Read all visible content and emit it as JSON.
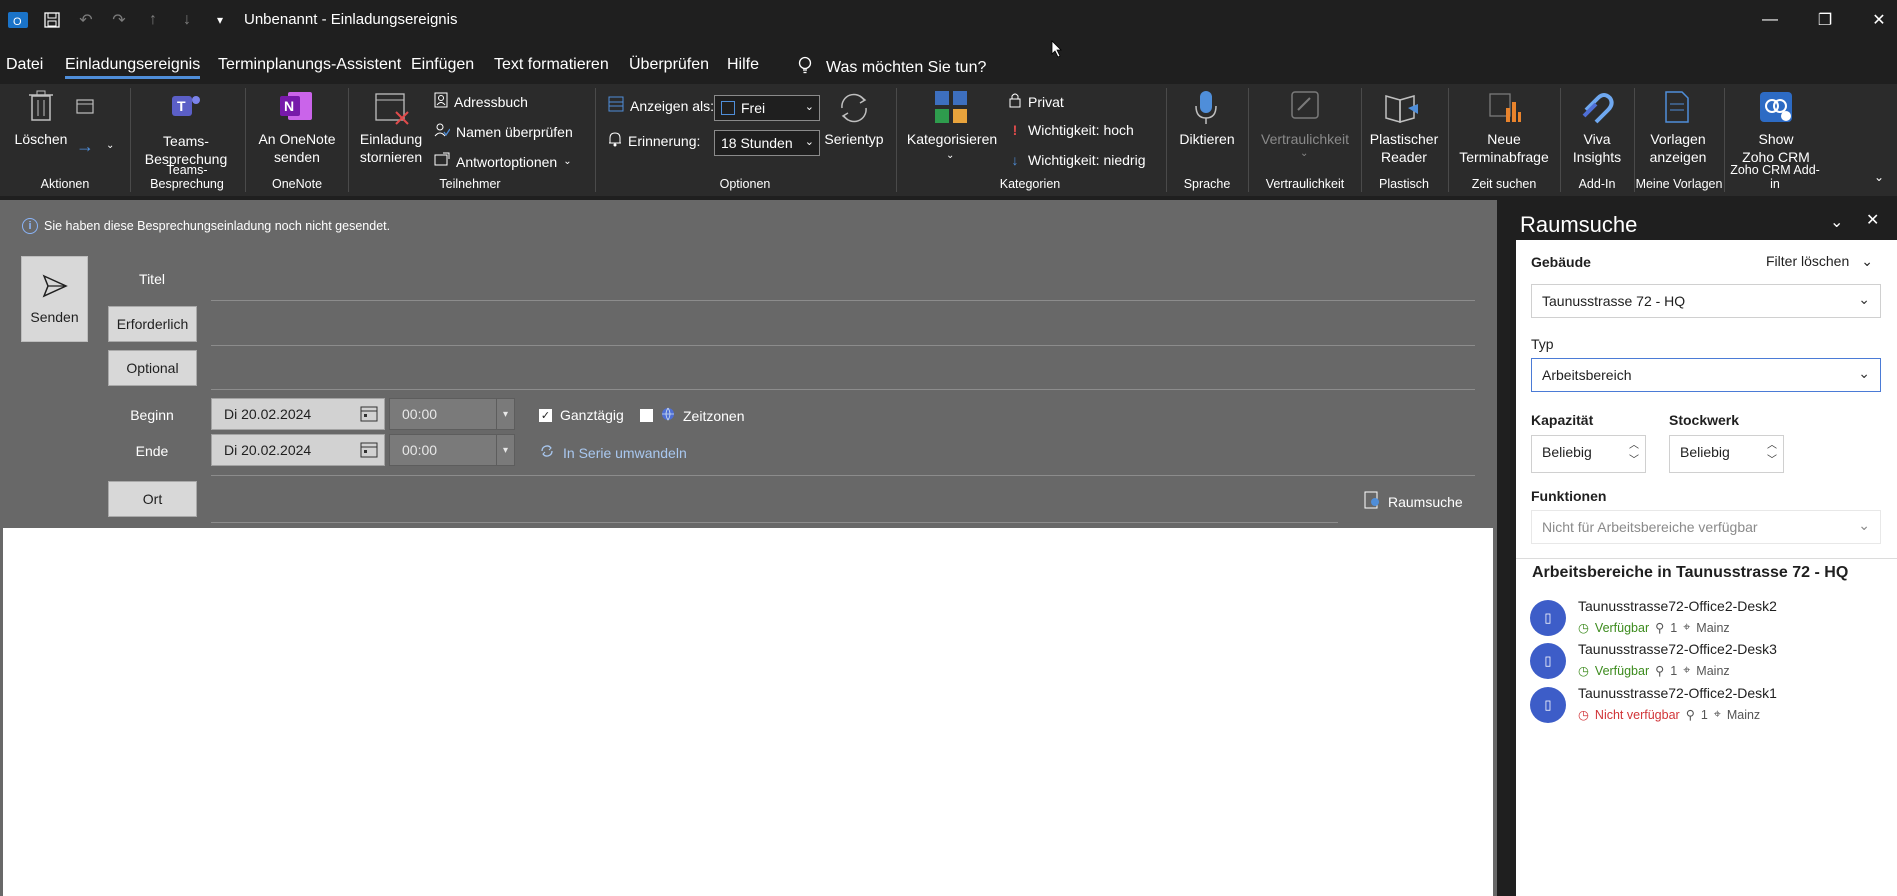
{
  "window": {
    "title": "Unbenannt  -  Einladungsereignis",
    "controls": {
      "minimize": "—",
      "restore": "❐",
      "close": "✕"
    }
  },
  "quick_access": [
    "save-icon",
    "undo-icon",
    "redo-icon",
    "up-icon",
    "down-icon",
    "customize-icon"
  ],
  "menu": {
    "tabs": [
      "Datei",
      "Einladungsereignis",
      "Terminplanungs-Assistent",
      "Einfügen",
      "Text formatieren",
      "Überprüfen",
      "Hilfe"
    ],
    "active": "Einladungsereignis",
    "search_placeholder": "Was möchten Sie tun?"
  },
  "ribbon": {
    "loeschen": "Löschen",
    "teams": "Teams-\nBesprechung",
    "onenote": "An OneNote\nsenden",
    "einladung_stornieren": "Einladung\nstornieren",
    "adressbuch": "Adressbuch",
    "namen_ueberpruefen": "Namen überprüfen",
    "antwortoptionen": "Antwortoptionen",
    "anzeigen_als": "Anzeigen als:",
    "anzeigen_value": "Frei",
    "erinnerung": "Erinnerung:",
    "erinnerung_value": "18 Stunden",
    "serientyp": "Serientyp",
    "kategorisieren": "Kategorisieren",
    "privat": "Privat",
    "wichtigkeit_hoch": "Wichtigkeit: hoch",
    "wichtigkeit_niedrig": "Wichtigkeit: niedrig",
    "diktieren": "Diktieren",
    "vertraulichkeit": "Vertraulichkeit",
    "plastischer_reader": "Plastischer\nReader",
    "neue_terminabfrage": "Neue\nTerminabfrage",
    "viva_insights": "Viva\nInsights",
    "vorlagen_anzeigen": "Vorlagen\nanzeigen",
    "zoho": "Show\nZoho CRM",
    "groups": {
      "aktionen": "Aktionen",
      "teams": "Teams-Besprechung",
      "onenote": "OneNote",
      "teilnehmer": "Teilnehmer",
      "optionen": "Optionen",
      "kategorien": "Kategorien",
      "sprache": "Sprache",
      "vertraulichkeit": "Vertraulichkeit",
      "plastisch": "Plastisch",
      "zeit_suchen": "Zeit suchen",
      "add_in": "Add-In",
      "meine_vorlagen": "Meine Vorlagen",
      "zoho": "Zoho CRM Add-in"
    }
  },
  "compose": {
    "info": "Sie haben diese Besprechungseinladung noch nicht gesendet.",
    "send": "Senden",
    "titel": "Titel",
    "erforderlich": "Erforderlich",
    "optional": "Optional",
    "beginn": "Beginn",
    "ende": "Ende",
    "beginn_date": "Di 20.02.2024",
    "beginn_time": "00:00",
    "ende_date": "Di 20.02.2024",
    "ende_time": "00:00",
    "ganztaegig": "Ganztägig",
    "ganztaegig_checked": true,
    "zeitzonen": "Zeitzonen",
    "serie": "In Serie umwandeln",
    "ort": "Ort",
    "raumsuche": "Raumsuche"
  },
  "pane": {
    "title": "Raumsuche",
    "gebaeude_label": "Gebäude",
    "filter_loeschen": "Filter löschen",
    "gebaeude_value": "Taunusstrasse 72 - HQ",
    "typ_label": "Typ",
    "typ_value": "Arbeitsbereich",
    "kapazitaet_label": "Kapazität",
    "kapazitaet_value": "Beliebig",
    "stockwerk_label": "Stockwerk",
    "stockwerk_value": "Beliebig",
    "funktionen_label": "Funktionen",
    "funktionen_value": "Nicht für Arbeitsbereiche verfügbar",
    "list_title": "Arbeitsbereiche in Taunusstrasse 72 - HQ",
    "rooms": [
      {
        "name": "Taunusstrasse72-Office2-Desk2",
        "status": "Verfügbar",
        "capacity": "1",
        "location": "Mainz",
        "available": true
      },
      {
        "name": "Taunusstrasse72-Office2-Desk3",
        "status": "Verfügbar",
        "capacity": "1",
        "location": "Mainz",
        "available": true
      },
      {
        "name": "Taunusstrasse72-Office2-Desk1",
        "status": "Nicht verfügbar",
        "capacity": "1",
        "location": "Mainz",
        "available": false
      }
    ]
  },
  "colors": {
    "accent": "#4f8ed9",
    "available": "#3c8b1d",
    "unavailable": "#d13438",
    "avatar": "#3d5dc8"
  }
}
